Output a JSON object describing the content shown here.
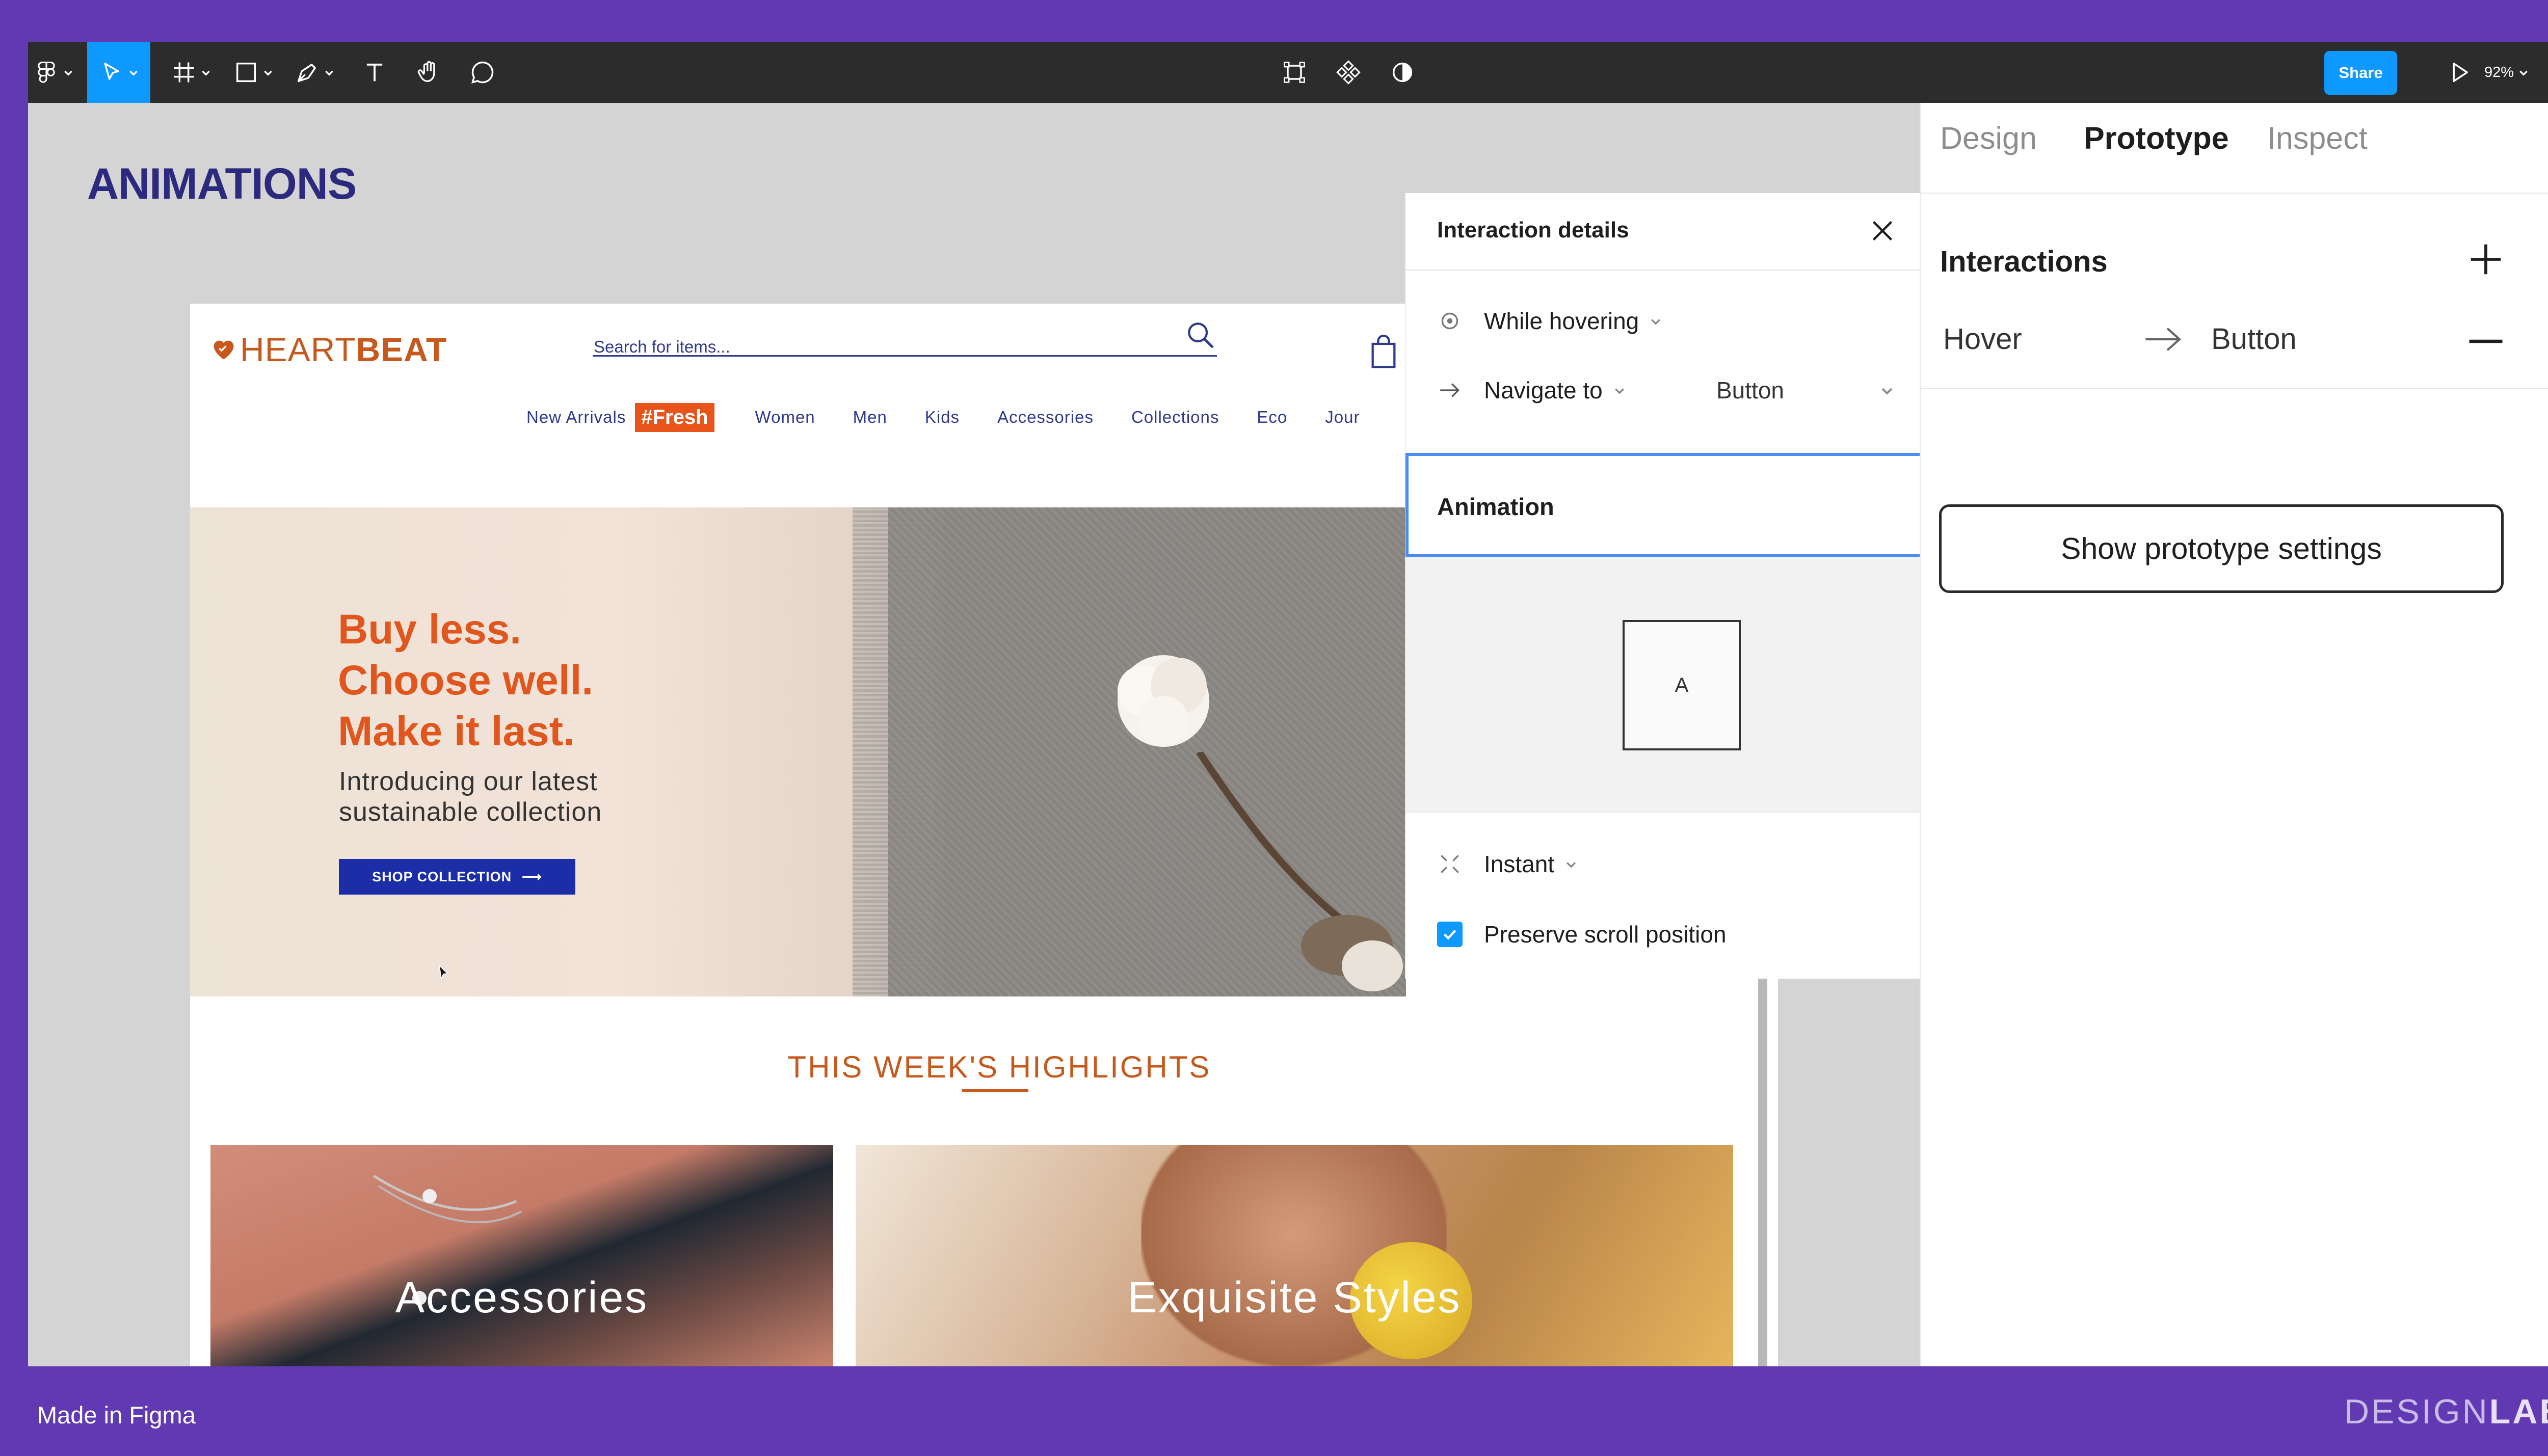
{
  "toolbar": {
    "share_label": "Share",
    "zoom": "92%",
    "tools": [
      "main-menu-icon",
      "move-icon",
      "frame-icon",
      "rectangle-icon",
      "pen-icon",
      "text-icon",
      "hand-icon",
      "comment-icon"
    ],
    "center_tools": [
      "edit-object-icon",
      "component-icon",
      "contrast-icon"
    ],
    "present_icon": "play-icon"
  },
  "canvas": {
    "heading": "ANIMATIONS"
  },
  "site": {
    "logo_left": "HEART",
    "logo_right": "BEAT",
    "search_placeholder": "Search for items...",
    "nav": {
      "new_arrivals": "New Arrivals",
      "fresh": "#Fresh",
      "women": "Women",
      "men": "Men",
      "kids": "Kids",
      "accessories": "Accessories",
      "collections": "Collections",
      "eco": "Eco",
      "journal": "Jour"
    },
    "hero": {
      "line1": "Buy less.",
      "line2": "Choose well.",
      "line3": "Make it last.",
      "sub1": "Introducing our latest",
      "sub2": "sustainable collection",
      "cta": "SHOP COLLECTION",
      "cta_arrow": "⟶"
    },
    "highlights_title": "THIS WEEK'S HIGHLIGHTS",
    "cards": {
      "accessories": "Accessories",
      "styles": "Exquisite Styles"
    }
  },
  "interaction_panel": {
    "title": "Interaction details",
    "trigger": "While hovering",
    "action": "Navigate to",
    "destination": "Button",
    "section": "Animation",
    "preview_letter": "A",
    "transition": "Instant",
    "preserve_scroll": "Preserve scroll position",
    "preserve_scroll_checked": true
  },
  "right_panel": {
    "tabs": {
      "design": "Design",
      "prototype": "Prototype",
      "inspect": "Inspect"
    },
    "active_tab": "Prototype",
    "interactions_header": "Interactions",
    "interaction_trigger": "Hover",
    "interaction_target": "Button",
    "settings_button": "Show prototype settings"
  },
  "footer": {
    "made_in": "Made in Figma",
    "brand_light": "DESIGN",
    "brand_bold": "LAB"
  },
  "colors": {
    "background": "#6139b3",
    "accent_blue": "#0d99ff",
    "brand_orange": "#e0561d",
    "heading_navy": "#2b2a7e",
    "cta_blue": "#1b2ea8"
  }
}
